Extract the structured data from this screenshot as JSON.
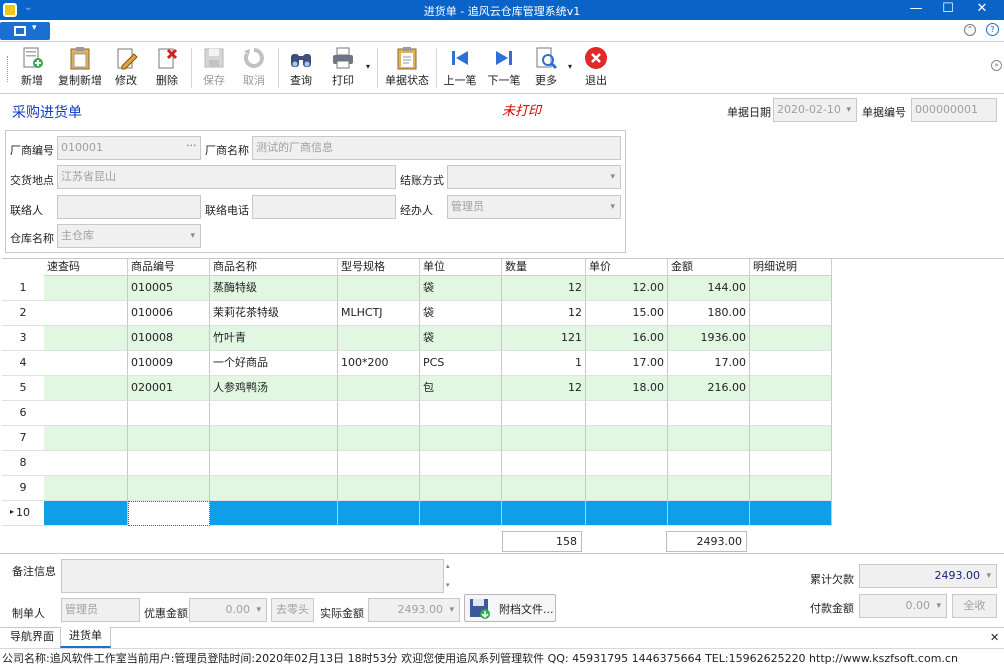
{
  "window": {
    "title": "进货单 - 追风云仓库管理系统v1",
    "min": "—",
    "max": "☐",
    "close": "✕"
  },
  "toolbar": {
    "buttons": [
      {
        "label": "新增",
        "icon": "new-doc-icon",
        "enabled": true
      },
      {
        "label": "复制新增",
        "icon": "copy-new-icon",
        "enabled": true
      },
      {
        "label": "修改",
        "icon": "edit-icon",
        "enabled": true
      },
      {
        "label": "删除",
        "icon": "delete-icon",
        "enabled": true
      },
      {
        "label": "保存",
        "icon": "save-icon",
        "enabled": false
      },
      {
        "label": "取消",
        "icon": "cancel-icon",
        "enabled": false
      },
      {
        "label": "查询",
        "icon": "binoculars-icon",
        "enabled": true
      },
      {
        "label": "打印",
        "icon": "printer-icon",
        "enabled": true
      },
      {
        "label": "单据状态",
        "icon": "clipboard-icon",
        "enabled": true
      },
      {
        "label": "上一笔",
        "icon": "prev-record-icon",
        "enabled": true
      },
      {
        "label": "下一笔",
        "icon": "next-record-icon",
        "enabled": true
      },
      {
        "label": "更多",
        "icon": "more-icon",
        "enabled": true
      },
      {
        "label": "退出",
        "icon": "exit-icon",
        "enabled": true
      }
    ]
  },
  "header": {
    "title": "采购进货单",
    "print_status": "未打印",
    "date_label": "单据日期",
    "date_value": "2020-02-10",
    "no_label": "单据编号",
    "no_value": "000000001"
  },
  "form": {
    "vendor_code_label": "厂商编号",
    "vendor_code": "010001",
    "vendor_code_btn": "···",
    "vendor_name_label": "厂商名称",
    "vendor_name": "测试的厂商信息",
    "delivery_label": "交货地点",
    "delivery": "江苏省昆山",
    "settle_label": "结账方式",
    "settle": "",
    "contact_label": "联络人",
    "contact": "",
    "phone_label": "联络电话",
    "phone": "",
    "handler_label": "经办人",
    "handler": "管理员",
    "warehouse_label": "仓库名称",
    "warehouse": "主仓库"
  },
  "grid": {
    "columns": [
      "速查码",
      "商品编号",
      "商品名称",
      "型号规格",
      "单位",
      "数量",
      "单价",
      "金额",
      "明细说明"
    ],
    "rows": [
      {
        "n": "1",
        "code": "",
        "sku": "010005",
        "name": "蒸酶特级",
        "spec": "",
        "unit": "袋",
        "qty": "12",
        "price": "12.00",
        "amount": "144.00",
        "note": ""
      },
      {
        "n": "2",
        "code": "",
        "sku": "010006",
        "name": "茉莉花茶特级",
        "spec": "MLHCTJ",
        "unit": "袋",
        "qty": "12",
        "price": "15.00",
        "amount": "180.00",
        "note": ""
      },
      {
        "n": "3",
        "code": "",
        "sku": "010008",
        "name": "竹叶青",
        "spec": "",
        "unit": "袋",
        "qty": "121",
        "price": "16.00",
        "amount": "1936.00",
        "note": ""
      },
      {
        "n": "4",
        "code": "",
        "sku": "010009",
        "name": "一个好商品",
        "spec": "100*200",
        "unit": "PCS",
        "qty": "1",
        "price": "17.00",
        "amount": "17.00",
        "note": ""
      },
      {
        "n": "5",
        "code": "",
        "sku": "020001",
        "name": "人参鸡鸭汤",
        "spec": "",
        "unit": "包",
        "qty": "12",
        "price": "18.00",
        "amount": "216.00",
        "note": ""
      },
      {
        "n": "6",
        "code": "",
        "sku": "",
        "name": "",
        "spec": "",
        "unit": "",
        "qty": "",
        "price": "",
        "amount": "",
        "note": ""
      },
      {
        "n": "7",
        "code": "",
        "sku": "",
        "name": "",
        "spec": "",
        "unit": "",
        "qty": "",
        "price": "",
        "amount": "",
        "note": ""
      },
      {
        "n": "8",
        "code": "",
        "sku": "",
        "name": "",
        "spec": "",
        "unit": "",
        "qty": "",
        "price": "",
        "amount": "",
        "note": ""
      },
      {
        "n": "9",
        "code": "",
        "sku": "",
        "name": "",
        "spec": "",
        "unit": "",
        "qty": "",
        "price": "",
        "amount": "",
        "note": ""
      },
      {
        "n": "10",
        "code": "",
        "sku": "",
        "name": "",
        "spec": "",
        "unit": "",
        "qty": "",
        "price": "",
        "amount": "",
        "note": ""
      }
    ],
    "current_row_marker": "▸",
    "total_qty": "158",
    "total_amount": "2493.00"
  },
  "footer": {
    "remark_label": "备注信息",
    "remark": "",
    "maker_label": "制单人",
    "maker": "管理员",
    "discount_label": "优惠金额",
    "discount": "0.00",
    "round_btn": "去零头",
    "actual_label": "实际金额",
    "actual": "2493.00",
    "attach_btn": "附档文件...",
    "owed_label": "累计欠款",
    "owed": "2493.00",
    "pay_label": "付款金额",
    "pay": "0.00",
    "full_btn": "全收"
  },
  "tabs": [
    "导航界面",
    "进货单"
  ],
  "status": "公司名称:追风软件工作室当前用户:管理员登陆时间:2020年02月13日 18时53分 欢迎您使用追风系列管理软件 QQ: 45931795 1446375664 TEL:15962625220 http://www.kszfsoft.com.cn",
  "colors": {
    "titlebar": "#0a64c8",
    "row_alt": "#e2f7e2",
    "row_selected": "#119ee8",
    "title_blue": "#0f3cc8",
    "status_red": "#d00000"
  }
}
